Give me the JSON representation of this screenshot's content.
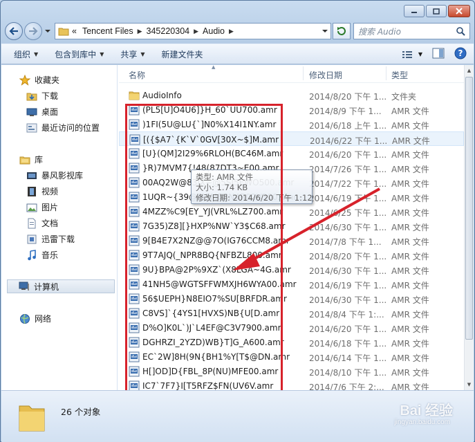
{
  "address": {
    "overflow": "«",
    "crumbs": [
      "Tencent Files",
      "345220304",
      "Audio"
    ]
  },
  "search": {
    "placeholder": "搜索 Audio"
  },
  "toolbar": {
    "organize": "组织",
    "include_library": "包含到库中",
    "share": "共享",
    "new_folder": "新建文件夹"
  },
  "nav": {
    "favorites": "收藏夹",
    "downloads": "下载",
    "desktop": "桌面",
    "recent": "最近访问的位置",
    "libraries": "库",
    "storm_video": "暴风影视库",
    "videos": "视频",
    "pictures": "图片",
    "documents": "文档",
    "thunder_download": "迅雷下载",
    "music": "音乐",
    "computer": "计算机",
    "network": "网络"
  },
  "columns": {
    "name": "名称",
    "date": "修改日期",
    "type": "类型"
  },
  "files": [
    {
      "name": "AudioInfo",
      "date": "2014/8/20 下午 1...",
      "type": "文件夹",
      "kind": "folder"
    },
    {
      "name": "(PL5[U]O4U6]}H_60`UU700.amr",
      "date": "2014/8/9 下午 1...",
      "type": "AMR 文件",
      "kind": "amr"
    },
    {
      "name": ")1FI(5U@LU{`]N0%X14I1NY.amr",
      "date": "2014/6/18 上午 1...",
      "type": "AMR 文件",
      "kind": "amr"
    },
    {
      "name": "[({$A7`{K`V`0GV[30X~$]M.amr",
      "date": "2014/6/22 下午 1...",
      "type": "AMR 文件",
      "kind": "amr"
    },
    {
      "name": "[U}(QM]2I29%6RLOH(BC46M.amr",
      "date": "2014/6/20 下午 1...",
      "type": "AMR 文件",
      "kind": "amr"
    },
    {
      "name": "}R)7MVM7{!48(87DT3~E00.amr",
      "date": "2014/7/26 下午 1...",
      "type": "AMR 文件",
      "kind": "amr"
    },
    {
      "name": "00AQ2W@83IX~@5SI5EWO500.amr",
      "date": "2014/7/22 下午 1...",
      "type": "AMR 文件",
      "kind": "amr"
    },
    {
      "name": "1UQR~{39@I6}MR8N4R02V300.amr",
      "date": "2014/6/19 下午 1...",
      "type": "AMR 文件",
      "kind": "amr"
    },
    {
      "name": "4MZZ%C9[EY_YJ(VRL%LZ700.amr",
      "date": "2014/6/25 下午 1...",
      "type": "AMR 文件",
      "kind": "amr"
    },
    {
      "name": "7G35)Z8][}HXP%NW`Y3$C68.amr",
      "date": "2014/6/30 下午 1...",
      "type": "AMR 文件",
      "kind": "amr"
    },
    {
      "name": "9[B4E7X2NZ@@7O(IG76CCM8.amr",
      "date": "2014/7/8 下午 1...",
      "type": "AMR 文件",
      "kind": "amr"
    },
    {
      "name": "9T7AJQ(_NPR8BQ{NFBZL800.amr",
      "date": "2014/8/20 下午 1...",
      "type": "AMR 文件",
      "kind": "amr"
    },
    {
      "name": "9U}BPA@2P%9XZ`(X8LGA~4G.amr",
      "date": "2014/6/30 下午 1...",
      "type": "AMR 文件",
      "kind": "amr"
    },
    {
      "name": "41NH5@WGTSFFWMXJH6WYA00.amr",
      "date": "2014/6/19 下午 1...",
      "type": "AMR 文件",
      "kind": "amr"
    },
    {
      "name": "56$UEPH}N8EIO7%SU[BRFDR.amr",
      "date": "2014/6/30 下午 1...",
      "type": "AMR 文件",
      "kind": "amr"
    },
    {
      "name": "C8VS]`{4YS1[HVXS)NB{U[D.amr",
      "date": "2014/8/4 下午 1:...",
      "type": "AMR 文件",
      "kind": "amr"
    },
    {
      "name": "D%O]K0L`)J`L4EF@C3V7900.amr",
      "date": "2014/6/20 下午 1...",
      "type": "AMR 文件",
      "kind": "amr"
    },
    {
      "name": "DGHRZI_2YZD)WB}T]G_A600.amr",
      "date": "2014/6/18 下午 1...",
      "type": "AMR 文件",
      "kind": "amr"
    },
    {
      "name": "EC`2W]8H(9N{BH1%Y[T$@DN.amr",
      "date": "2014/6/14 下午 1...",
      "type": "AMR 文件",
      "kind": "amr"
    },
    {
      "name": "H[]OD]D{FBL_8P(NU)MFE00.amr",
      "date": "2014/8/10 下午 1...",
      "type": "AMR 文件",
      "kind": "amr"
    },
    {
      "name": "IC7`7F7}I[T5RFZ$FN(UV6V.amr",
      "date": "2014/7/6 下午 2:...",
      "type": "AMR 文件",
      "kind": "amr"
    }
  ],
  "tooltip": {
    "type_line": "类型: AMR 文件",
    "size_line": "大小: 1.74 KB",
    "date_line": "修改日期: 2014/6/20 下午 1:12"
  },
  "details": {
    "count": "26 个对象"
  },
  "watermark": {
    "text": "Bai 经验",
    "sub": "jingyan.baidu.com"
  },
  "colors": {
    "annotation_red": "#d7222b",
    "window_chrome": "#b6cde6",
    "hover_row": "#eaf3fc"
  }
}
